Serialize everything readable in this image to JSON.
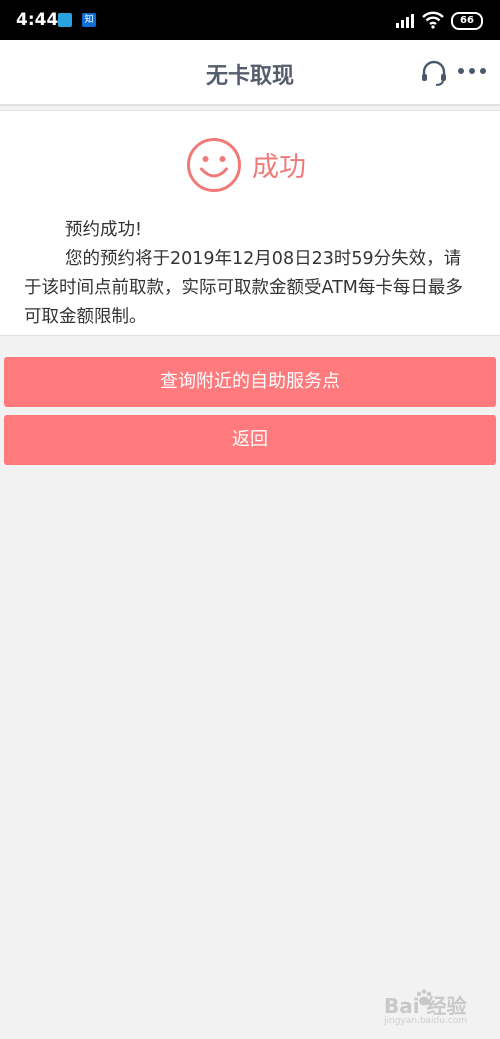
{
  "status_bar": {
    "time": "4:44",
    "app_icon_2_text": "知",
    "battery": "66"
  },
  "header": {
    "title": "无卡取现",
    "headset_icon": "headset-icon",
    "more_icon": "more-icon"
  },
  "result": {
    "icon": "smiley-icon",
    "title": "成功",
    "line1": "预约成功!",
    "line2": "您的预约将于2019年12月08日23时59分失效，请于该时间点前取款，实际可取款金额受ATM每卡每日最多可取金额限制。"
  },
  "buttons": {
    "nearby": "查询附近的自助服务点",
    "back": "返回"
  },
  "watermark": {
    "main": "Bai 经验",
    "sub": "jingyan.baidu.com"
  },
  "colors": {
    "accent": "#ff7a7d",
    "success": "#f07a7a",
    "title": "#555d6d"
  }
}
